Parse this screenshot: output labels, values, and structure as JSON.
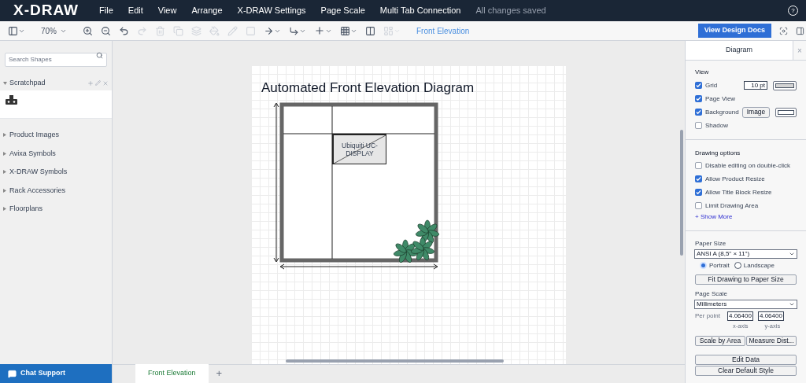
{
  "menubar": {
    "logo": "X-DRAW",
    "items": [
      "File",
      "Edit",
      "View",
      "Arrange",
      "X-DRAW Settings",
      "Page Scale",
      "Multi Tab Connection"
    ],
    "status": "All changes saved",
    "help": "?"
  },
  "toolbar": {
    "zoom": "70%",
    "page_link": "Front Elevation",
    "docs_button": "View Design Docs"
  },
  "sidebar": {
    "search": {
      "placeholder": "Search Shapes"
    },
    "scratchpad": "Scratchpad",
    "sections": [
      "Product Images",
      "Avixa Symbols",
      "X-DRAW Symbols",
      "Rack Accessories",
      "Floorplans"
    ],
    "chat": "Chat Support"
  },
  "diagram": {
    "title": "Automated Front Elevation Diagram",
    "device_label": "Ubiquiti UC-DISPLAY"
  },
  "tabs": [
    {
      "label": "Front Elevation",
      "selected": true
    }
  ],
  "add_tab": "+",
  "panel": {
    "title": "Diagram",
    "close": "×",
    "view_heading": "View",
    "view_options": [
      {
        "kind": "grid",
        "label": "Grid",
        "checked": true,
        "value": "10 pt"
      },
      {
        "kind": "plain",
        "label": "Page View",
        "checked": true
      },
      {
        "kind": "background",
        "label": "Background",
        "checked": true,
        "button": "Image"
      },
      {
        "kind": "plain",
        "label": "Shadow",
        "checked": false
      }
    ],
    "drawing_heading": "Drawing options",
    "drawing_options": [
      {
        "label": "Disable editing on double-click",
        "checked": false
      },
      {
        "label": "Allow Product Resize",
        "checked": true
      },
      {
        "label": "Allow Title Block Resize",
        "checked": true
      },
      {
        "label": "Limit Drawing Area",
        "checked": false
      }
    ],
    "show_more": "+ Show More",
    "paper_heading": "Paper Size",
    "paper_size": "ANSI A (8,5\" × 11\")",
    "orientations": [
      {
        "label": "Portrait",
        "selected": true
      },
      {
        "label": "Landscape",
        "selected": false
      }
    ],
    "fit_button": "Fit Drawing to Paper Size",
    "scale_heading": "Page Scale",
    "units": "Millimeters",
    "per_point": "Per point",
    "x_value": "4.06400",
    "y_value": "4.06400",
    "x_label": "x-axis",
    "y_label": "y-axis",
    "scale_buttons": [
      "Scale by Area",
      "Measure Dist..."
    ],
    "bottom_buttons": [
      "Edit Data",
      "Clear Default Style"
    ]
  }
}
